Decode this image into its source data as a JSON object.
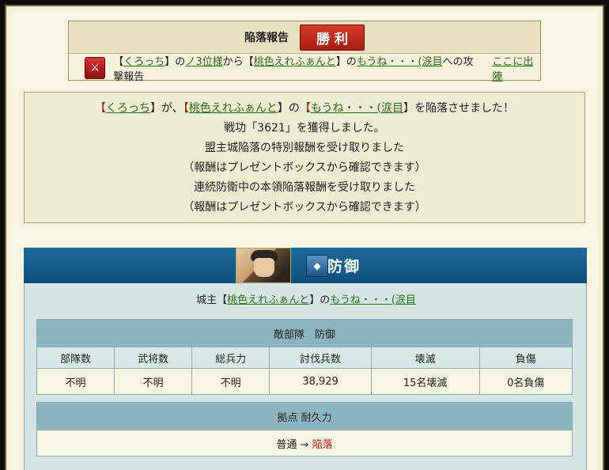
{
  "header": {
    "title": "陥落報告",
    "result": "勝利",
    "report": {
      "bracket_open": "【",
      "attacker": "くろっち",
      "bracket_close": "】",
      "no": "の",
      "attacker_title": "ノ3位様",
      "kara": "から",
      "target_alliance": "桃色えれふぁんと",
      "target_castle": "もうね・・・(涙目",
      "suffix": "への攻撃報告",
      "action_link": "ここに出陣"
    }
  },
  "message": {
    "line1": {
      "b1": "【",
      "attacker": "くろっち",
      "b2": "】が、",
      "b3": "【",
      "alliance": "桃色えれふぁんと",
      "b4": "】の",
      "b5": "【",
      "castle": "もうね・・・(涙目",
      "b6": "】を陥落させました！"
    },
    "line2": "戦功「3621」を獲得しました。",
    "line3": "盟主城陥落の特別報酬を受け取りました",
    "line4": "（報酬はプレゼントボックスから確認できます）",
    "line5": "連続防衛中の本領陥落報酬を受け取りました",
    "line6": "（報酬はプレゼントボックスから確認できます）"
  },
  "defense": {
    "label": "防御",
    "lord_prefix": "城主【",
    "lord_alliance": "桃色えれふぁんと",
    "lord_mid": "】の",
    "lord_castle": "もうね・・・(涙目",
    "table_caption": "敵部隊　防御",
    "columns": [
      "部隊数",
      "武将数",
      "総兵力",
      "討伐兵数",
      "壊滅",
      "負傷"
    ],
    "row": [
      "不明",
      "不明",
      "不明",
      "38,929",
      "15名壊滅",
      "0名負傷"
    ],
    "durability_caption": "拠点 耐久力",
    "durability_from": "普通",
    "arrow": "→",
    "durability_to": "陥落"
  },
  "colors": {
    "band": "#1c6a9a",
    "victory": "#c0281a",
    "link": "#2a6e16",
    "fallen": "#c81a10"
  },
  "icons": {
    "report": "crossed-swords-icon",
    "defense": "shield-icon"
  }
}
